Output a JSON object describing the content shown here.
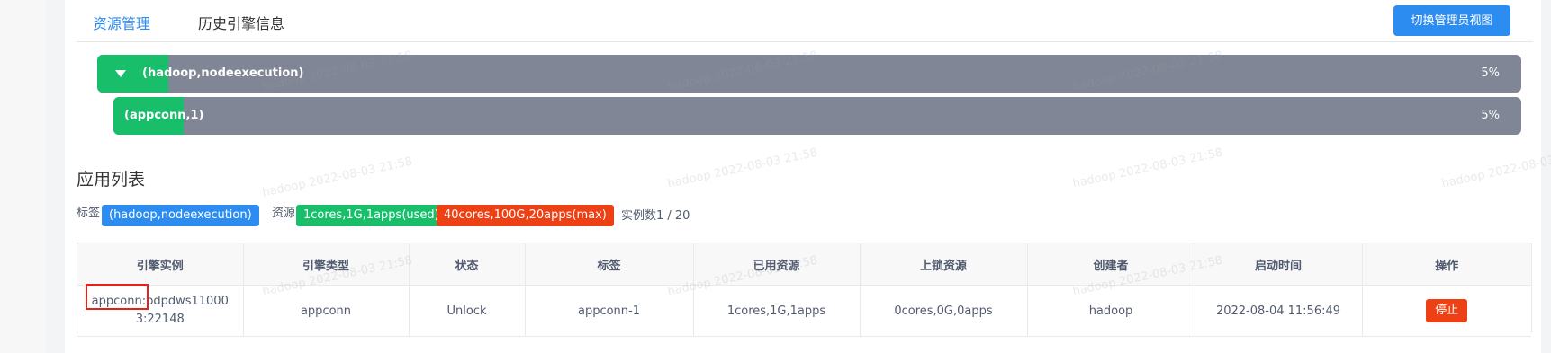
{
  "tabs": [
    {
      "label": "资源管理",
      "active": true
    },
    {
      "label": "历史引擎信息",
      "active": false
    }
  ],
  "switch_button": "切换管理员视图",
  "resource_bars": [
    {
      "label": "(hadoop,nodeexecution)",
      "percent_text": "5%",
      "usage_fraction": 0.05,
      "expandable": true
    },
    {
      "label": "(appconn,1)",
      "percent_text": "5%",
      "usage_fraction": 0.05,
      "expandable": false
    }
  ],
  "section_title": "应用列表",
  "meta": {
    "tag_label": "标签",
    "tag_value": "(hadoop,nodeexecution)",
    "resource_label": "资源",
    "used_resource": "1cores,1G,1apps(used)",
    "max_resource": "40cores,100G,20apps(max)",
    "instances": "实例数1 / 20"
  },
  "table": {
    "columns": [
      "引擎实例",
      "引擎类型",
      "状态",
      "标签",
      "已用资源",
      "上锁资源",
      "创建者",
      "启动时间",
      "操作"
    ],
    "rows": [
      {
        "instance": "appconn:bdpdws110003:22148",
        "type": "appconn",
        "status": "Unlock",
        "label": "appconn-1",
        "used": "1cores,1G,1apps",
        "locked": "0cores,0G,0apps",
        "creator": "hadoop",
        "start_time": "2022-08-04 11:56:49",
        "action": "停止"
      }
    ]
  },
  "watermark": "hadoop 2022-08-03 21:58",
  "colors": {
    "primary": "#2d8cf0",
    "success": "#19be6b",
    "error": "#ed4014",
    "bar_bg": "#808695"
  }
}
